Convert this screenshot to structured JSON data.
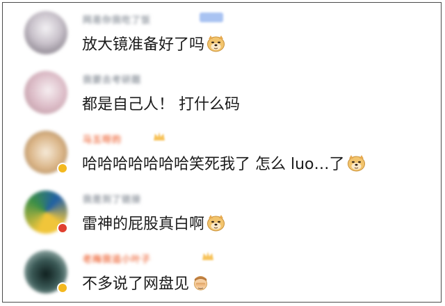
{
  "comments": [
    {
      "username": "网易你我吃了饭",
      "username_color": "#9aa0a8",
      "badge": "vip",
      "text": "放大镜准备好了吗",
      "emoji": "doge-icon",
      "avatar_colors": [
        "#e8e6ea",
        "#b9b4bb",
        "#6f6873"
      ]
    },
    {
      "username": "我要去考研题",
      "username_color": "#9aa0a8",
      "badge": "",
      "text": "都是自己人！ 打什么码",
      "emoji": "",
      "avatar_colors": [
        "#f1e6ea",
        "#d9b7c2",
        "#b58e97"
      ]
    },
    {
      "username": "马五呀的",
      "username_color": "#f07a52",
      "badge": "crown",
      "text": "哈哈哈哈哈哈哈笑死我了 怎么 luo…了",
      "emoji": "doge-icon",
      "avatar_colors": [
        "#f2e3cf",
        "#d9b385",
        "#9a7a55"
      ],
      "avatar_badge_color": "#f3b81f"
    },
    {
      "username": "我是到了链接",
      "username_color": "#9aa0a8",
      "badge": "",
      "text": "雷神的屁股真白啊",
      "emoji": "doge-icon",
      "avatar_colors": [
        "#f0c53a",
        "#3c8f46",
        "#1f5fa6"
      ],
      "avatar_badge_color": "#e0402f"
    },
    {
      "username": "老梅我追小叶子",
      "username_color": "#f07a52",
      "badge": "crown",
      "text": "不多说了网盘见",
      "emoji": "face-palm-icon",
      "avatar_colors": [
        "#cfe3df",
        "#3b5a57",
        "#0f1f1e"
      ],
      "avatar_badge_color": "#f3b81f"
    }
  ],
  "colors": {
    "text": "#1a1a1a",
    "vip_tag": "#a9c3f2",
    "crown": "#f7c35a"
  }
}
